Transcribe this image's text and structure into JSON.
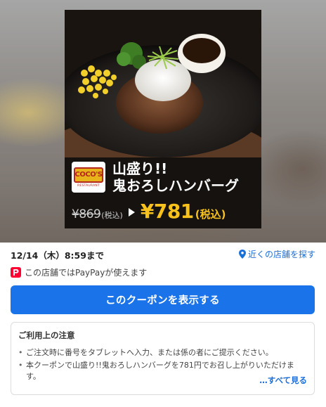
{
  "promo": {
    "brand_logo_text": "COCO'S",
    "brand_logo_sub": "RESTAURANT",
    "item_name": "山盛り!!\n鬼おろしハンバーグ",
    "old_price": "¥869",
    "old_price_tax": "(税込)",
    "new_price": "¥781",
    "new_price_tax": "(税込)",
    "price_color": "#f7c21b"
  },
  "coupon": {
    "expiry": "12/14（木）8:59まで",
    "nearby_stores_label": "近くの店舗を探す",
    "paypay_text": "この店舗ではPayPayが使えます",
    "show_coupon_label": "このクーポンを表示する"
  },
  "notes": {
    "title": "ご利用上の注意",
    "items": [
      "ご注文時に番号をタブレットへ入力、または係の者にご提示ください。",
      "本クーポンで山盛り!!鬼おろしハンバーグを781円でお召し上がりいただけます。"
    ],
    "see_all_label": "…すべて見る"
  },
  "colors": {
    "accent": "#1a73e8",
    "link": "#1b6fd8",
    "paypay": "#ff0033"
  },
  "icons": {
    "location": "map-pin-icon",
    "paypay": "paypay-icon"
  }
}
